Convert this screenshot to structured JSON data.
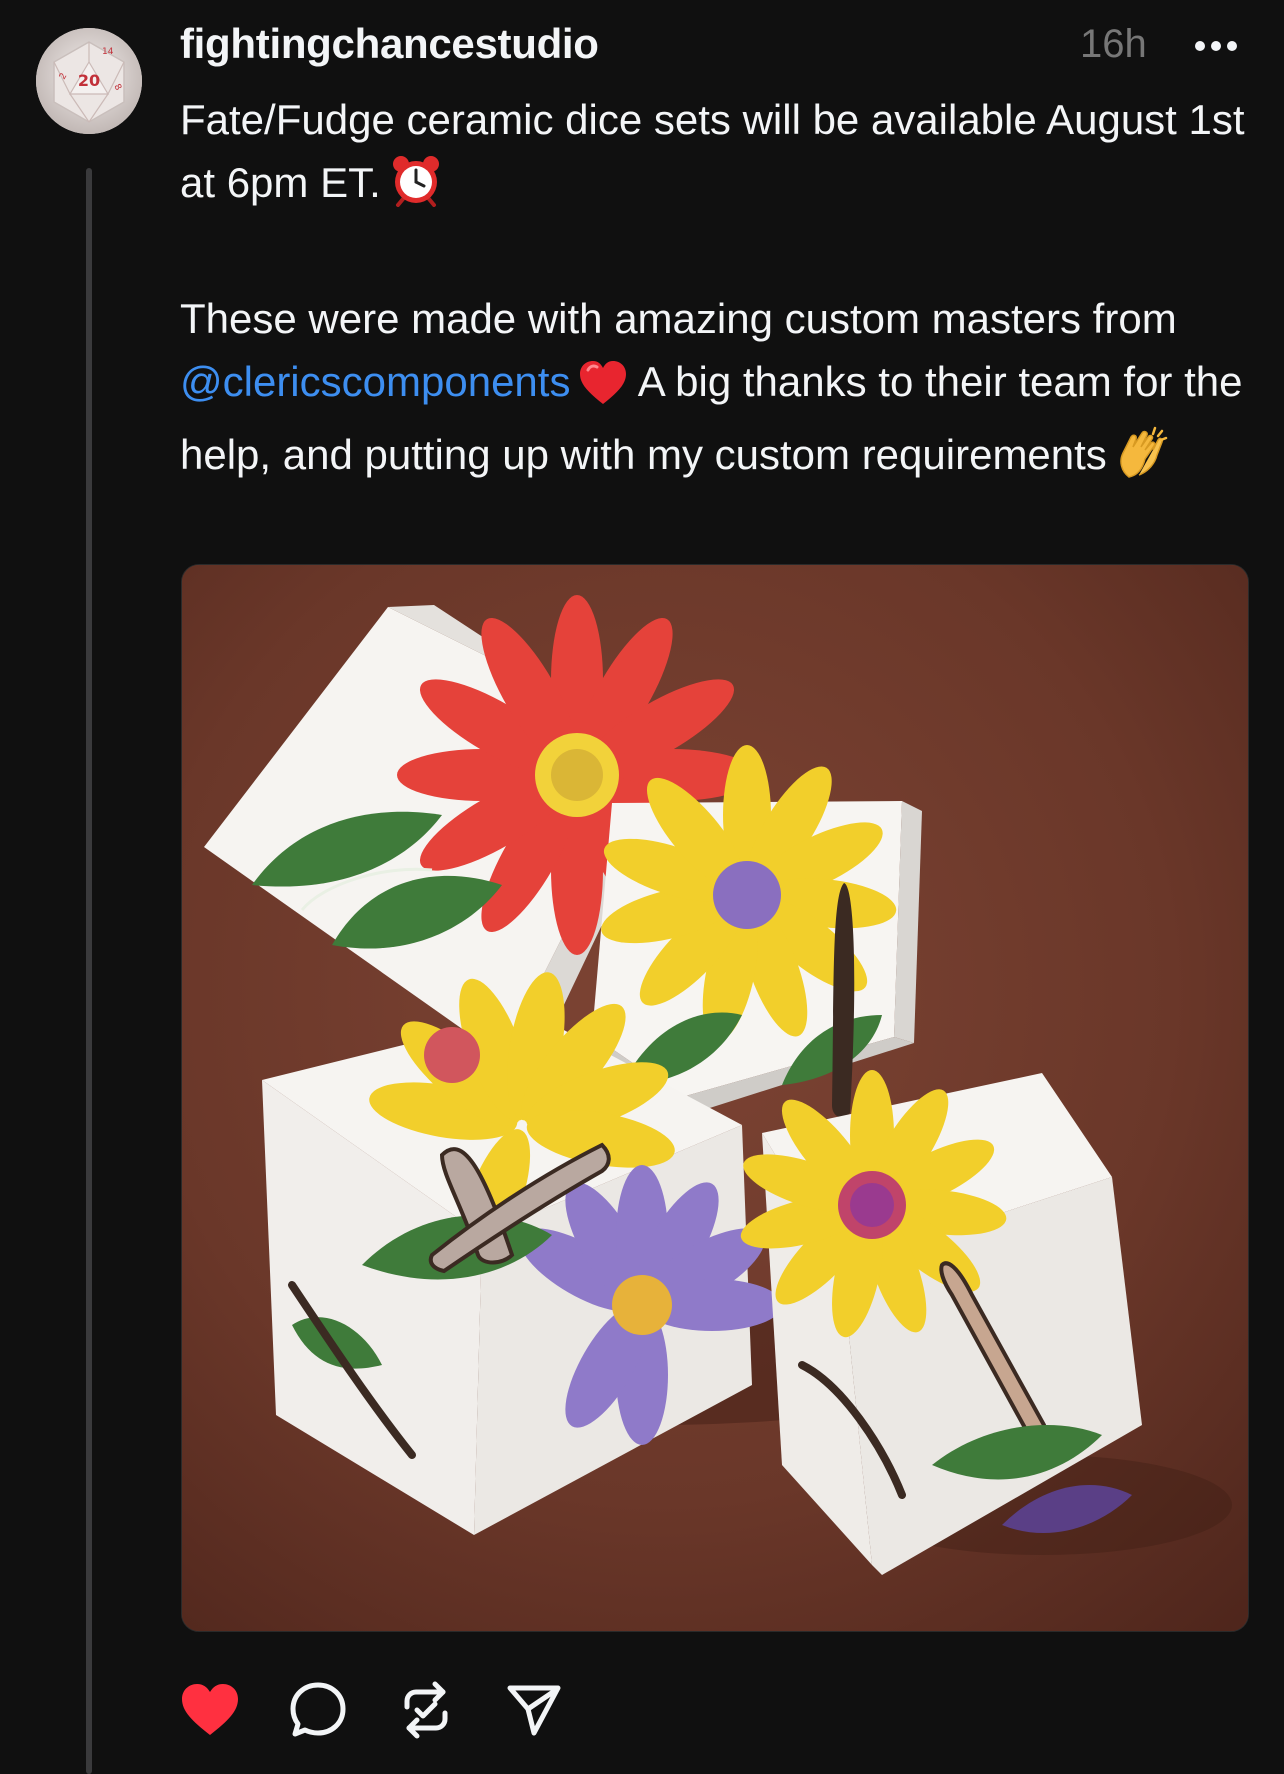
{
  "post": {
    "username": "fightingchancestudio",
    "timestamp": "16h",
    "text": {
      "line1": "Fate/Fudge ceramic dice sets will be available August 1st at 6pm ET.",
      "p2_before": "These were made with amazing custom masters from ",
      "mention": "@clericscomponents",
      "p2_after": " A big thanks to their team for the help, and putting up with my custom requirements"
    },
    "image_alt": "Four white ceramic Fate/Fudge dice decorated with red, yellow and purple flowers on a brown suede surface",
    "liked": true
  },
  "icons": {
    "avatar": "d20-die-avatar",
    "more": "more-horizontal-icon",
    "clock_emoji": "alarm-clock-emoji",
    "heart_emoji": "red-heart-emoji",
    "clap_emoji": "clapping-hands-emoji",
    "like": "heart-icon",
    "reply": "comment-bubble-icon",
    "repost": "repost-icon",
    "share": "send-icon"
  },
  "colors": {
    "background": "#101010",
    "text": "#f3f5f7",
    "muted": "#777777",
    "mention": "#3d8ef0",
    "like_active": "#ff3040",
    "thread_line": "#3a3a3c"
  }
}
